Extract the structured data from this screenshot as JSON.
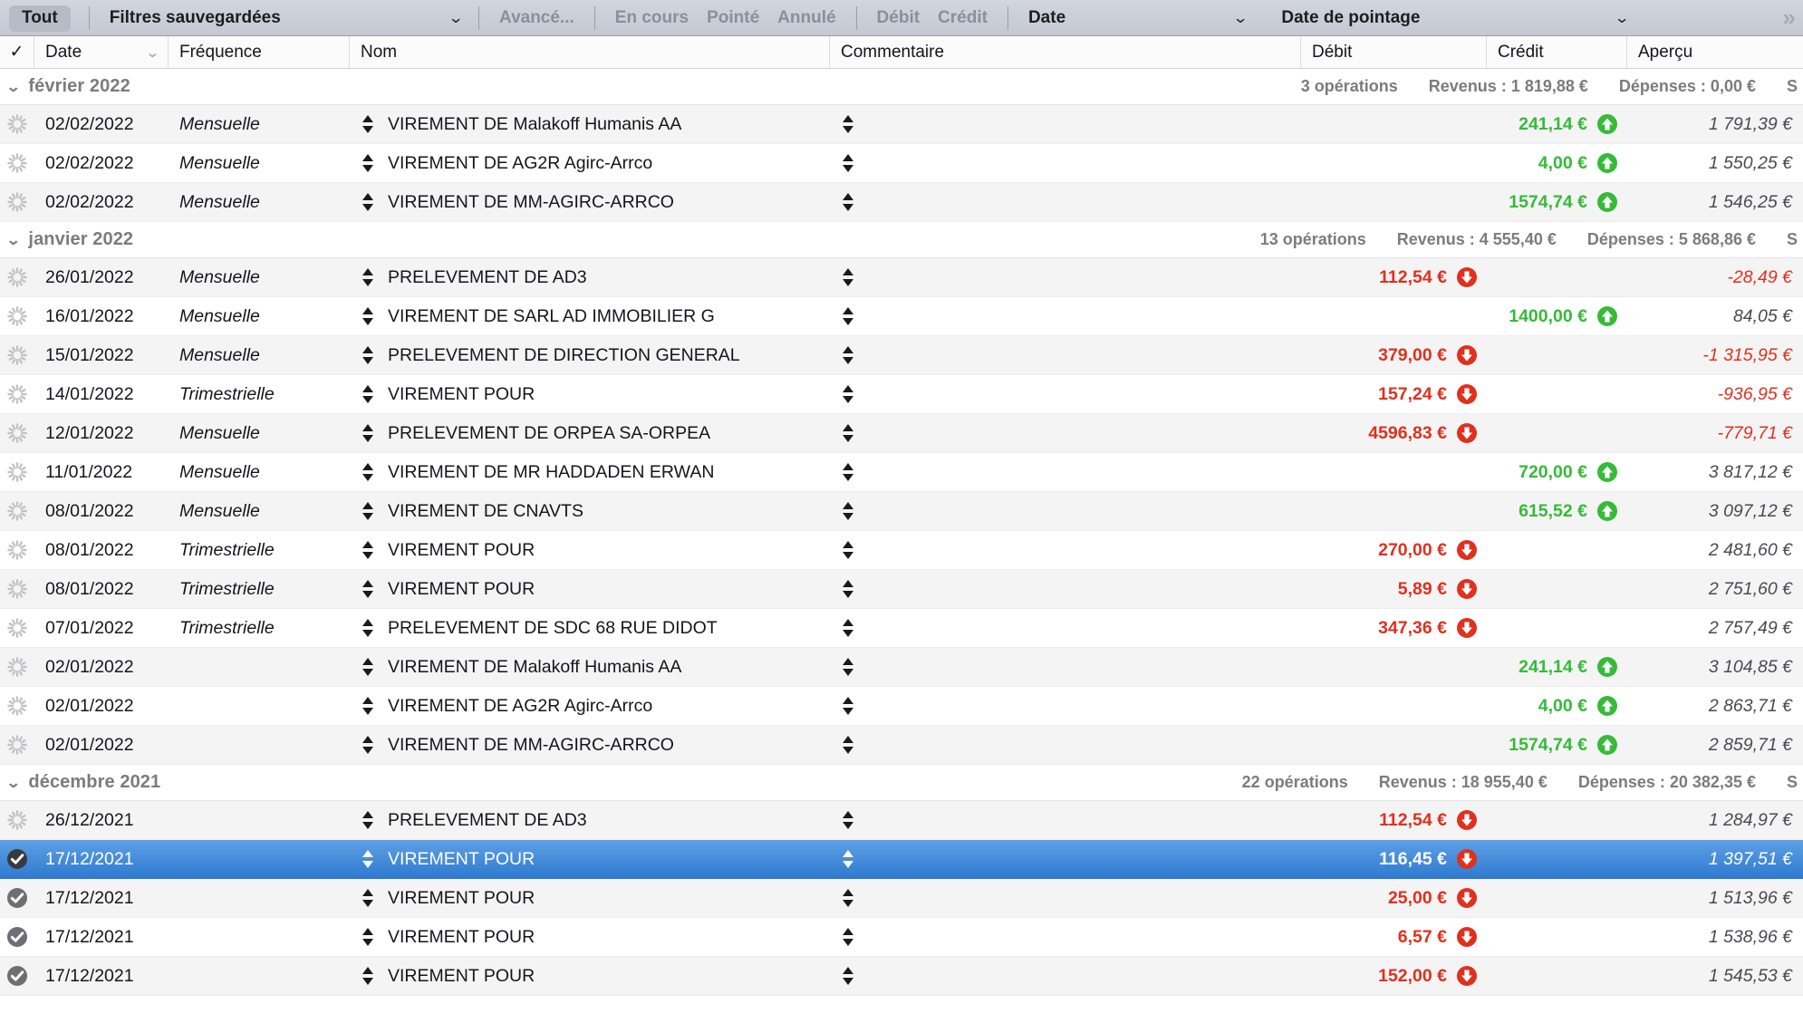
{
  "toolbar": {
    "all_label": "Tout",
    "saved_filters_label": "Filtres sauvegardées",
    "advanced_label": "Avancé...",
    "pending_label": "En cours",
    "checked_label": "Pointé",
    "cancelled_label": "Annulé",
    "debit_label": "Débit",
    "credit_label": "Crédit",
    "date_label": "Date",
    "pointing_date_label": "Date de pointage",
    "overflow_label": "»",
    "chevron": "⌄"
  },
  "columns": {
    "check": "✓",
    "date": "Date",
    "frequency": "Fréquence",
    "name": "Nom",
    "comment": "Commentaire",
    "debit": "Débit",
    "credit": "Crédit",
    "preview": "Aperçu",
    "sort_arrow": "⌄"
  },
  "groups": [
    {
      "title": "février 2022",
      "operations": "3 opérations",
      "revenues": "Revenus : 1 819,88 €",
      "expenses": "Dépenses : 0,00 €",
      "solde_clipped": "S",
      "rows": [
        {
          "status": "pending",
          "date": "02/02/2022",
          "frequency": "Mensuelle",
          "name": "VIREMENT DE Malakoff Humanis AA",
          "comment": "",
          "debit": "",
          "credit": "241,14 €",
          "balance": "1 791,39 €",
          "balance_negative": false,
          "selected": false
        },
        {
          "status": "pending",
          "date": "02/02/2022",
          "frequency": "Mensuelle",
          "name": "VIREMENT DE AG2R Agirc-Arrco",
          "comment": "",
          "debit": "",
          "credit": "4,00 €",
          "balance": "1 550,25 €",
          "balance_negative": false,
          "selected": false
        },
        {
          "status": "pending",
          "date": "02/02/2022",
          "frequency": "Mensuelle",
          "name": "VIREMENT DE MM-AGIRC-ARRCO",
          "comment": "",
          "debit": "",
          "credit": "1574,74 €",
          "balance": "1 546,25 €",
          "balance_negative": false,
          "selected": false
        }
      ]
    },
    {
      "title": "janvier 2022",
      "operations": "13 opérations",
      "revenues": "Revenus : 4 555,40 €",
      "expenses": "Dépenses : 5 868,86 €",
      "solde_clipped": "S",
      "rows": [
        {
          "status": "pending",
          "date": "26/01/2022",
          "frequency": "Mensuelle",
          "name": "PRELEVEMENT DE AD3",
          "comment": "",
          "debit": "112,54 €",
          "credit": "",
          "balance": "-28,49 €",
          "balance_negative": true,
          "selected": false
        },
        {
          "status": "pending",
          "date": "16/01/2022",
          "frequency": "Mensuelle",
          "name": "VIREMENT DE SARL AD IMMOBILIER G",
          "comment": "",
          "debit": "",
          "credit": "1400,00 €",
          "balance": "84,05 €",
          "balance_negative": false,
          "selected": false
        },
        {
          "status": "pending",
          "date": "15/01/2022",
          "frequency": "Mensuelle",
          "name": "PRELEVEMENT DE DIRECTION GENERAL",
          "comment": "",
          "debit": "379,00 €",
          "credit": "",
          "balance": "-1 315,95 €",
          "balance_negative": true,
          "selected": false
        },
        {
          "status": "pending",
          "date": "14/01/2022",
          "frequency": "Trimestrielle",
          "name": "VIREMENT POUR",
          "comment": "",
          "debit": "157,24 €",
          "credit": "",
          "balance": "-936,95 €",
          "balance_negative": true,
          "selected": false
        },
        {
          "status": "pending",
          "date": "12/01/2022",
          "frequency": "Mensuelle",
          "name": "PRELEVEMENT DE ORPEA SA-ORPEA",
          "comment": "",
          "debit": "4596,83 €",
          "credit": "",
          "balance": "-779,71 €",
          "balance_negative": true,
          "selected": false
        },
        {
          "status": "pending",
          "date": "11/01/2022",
          "frequency": "Mensuelle",
          "name": "VIREMENT DE MR HADDADEN ERWAN",
          "comment": "",
          "debit": "",
          "credit": "720,00 €",
          "balance": "3 817,12 €",
          "balance_negative": false,
          "selected": false
        },
        {
          "status": "pending",
          "date": "08/01/2022",
          "frequency": "Mensuelle",
          "name": "VIREMENT DE CNAVTS",
          "comment": "",
          "debit": "",
          "credit": "615,52 €",
          "balance": "3 097,12 €",
          "balance_negative": false,
          "selected": false
        },
        {
          "status": "pending",
          "date": "08/01/2022",
          "frequency": "Trimestrielle",
          "name": "VIREMENT POUR",
          "comment": "",
          "debit": "270,00 €",
          "credit": "",
          "balance": "2 481,60 €",
          "balance_negative": false,
          "selected": false
        },
        {
          "status": "pending",
          "date": "08/01/2022",
          "frequency": "Trimestrielle",
          "name": "VIREMENT POUR",
          "comment": "",
          "debit": "5,89 €",
          "credit": "",
          "balance": "2 751,60 €",
          "balance_negative": false,
          "selected": false
        },
        {
          "status": "pending",
          "date": "07/01/2022",
          "frequency": "Trimestrielle",
          "name": "PRELEVEMENT DE SDC 68 RUE DIDOT",
          "comment": "",
          "debit": "347,36 €",
          "credit": "",
          "balance": "2 757,49 €",
          "balance_negative": false,
          "selected": false
        },
        {
          "status": "pending",
          "date": "02/01/2022",
          "frequency": "",
          "name": "VIREMENT DE Malakoff Humanis AA",
          "comment": "",
          "debit": "",
          "credit": "241,14 €",
          "balance": "3 104,85 €",
          "balance_negative": false,
          "selected": false
        },
        {
          "status": "pending",
          "date": "02/01/2022",
          "frequency": "",
          "name": "VIREMENT DE AG2R Agirc-Arrco",
          "comment": "",
          "debit": "",
          "credit": "4,00 €",
          "balance": "2 863,71 €",
          "balance_negative": false,
          "selected": false
        },
        {
          "status": "pending",
          "date": "02/01/2022",
          "frequency": "",
          "name": "VIREMENT DE MM-AGIRC-ARRCO",
          "comment": "",
          "debit": "",
          "credit": "1574,74 €",
          "balance": "2 859,71 €",
          "balance_negative": false,
          "selected": false
        }
      ]
    },
    {
      "title": "décembre 2021",
      "operations": "22 opérations",
      "revenues": "Revenus : 18 955,40 €",
      "expenses": "Dépenses : 20 382,35 €",
      "solde_clipped": "S",
      "rows": [
        {
          "status": "pending",
          "date": "26/12/2021",
          "frequency": "",
          "name": "PRELEVEMENT DE AD3",
          "comment": "",
          "debit": "112,54 €",
          "credit": "",
          "balance": "1 284,97 €",
          "balance_negative": false,
          "selected": false
        },
        {
          "status": "checked",
          "date": "17/12/2021",
          "frequency": "",
          "name": "VIREMENT POUR",
          "comment": "",
          "debit": "116,45 €",
          "credit": "",
          "balance": "1 397,51 €",
          "balance_negative": false,
          "selected": true
        },
        {
          "status": "checked",
          "date": "17/12/2021",
          "frequency": "",
          "name": "VIREMENT POUR",
          "comment": "",
          "debit": "25,00 €",
          "credit": "",
          "balance": "1 513,96 €",
          "balance_negative": false,
          "selected": false
        },
        {
          "status": "checked",
          "date": "17/12/2021",
          "frequency": "",
          "name": "VIREMENT POUR",
          "comment": "",
          "debit": "6,57 €",
          "credit": "",
          "balance": "1 538,96 €",
          "balance_negative": false,
          "selected": false
        },
        {
          "status": "checked",
          "date": "17/12/2021",
          "frequency": "",
          "name": "VIREMENT POUR",
          "comment": "",
          "debit": "152,00 €",
          "credit": "",
          "balance": "1 545,53 €",
          "balance_negative": false,
          "selected": false
        }
      ]
    }
  ],
  "colors": {
    "credit_green": "#35bb38",
    "debit_red": "#e0301e",
    "selection_blue": "#2f7ad0",
    "toolbar_gray": "#c9cdd6"
  }
}
